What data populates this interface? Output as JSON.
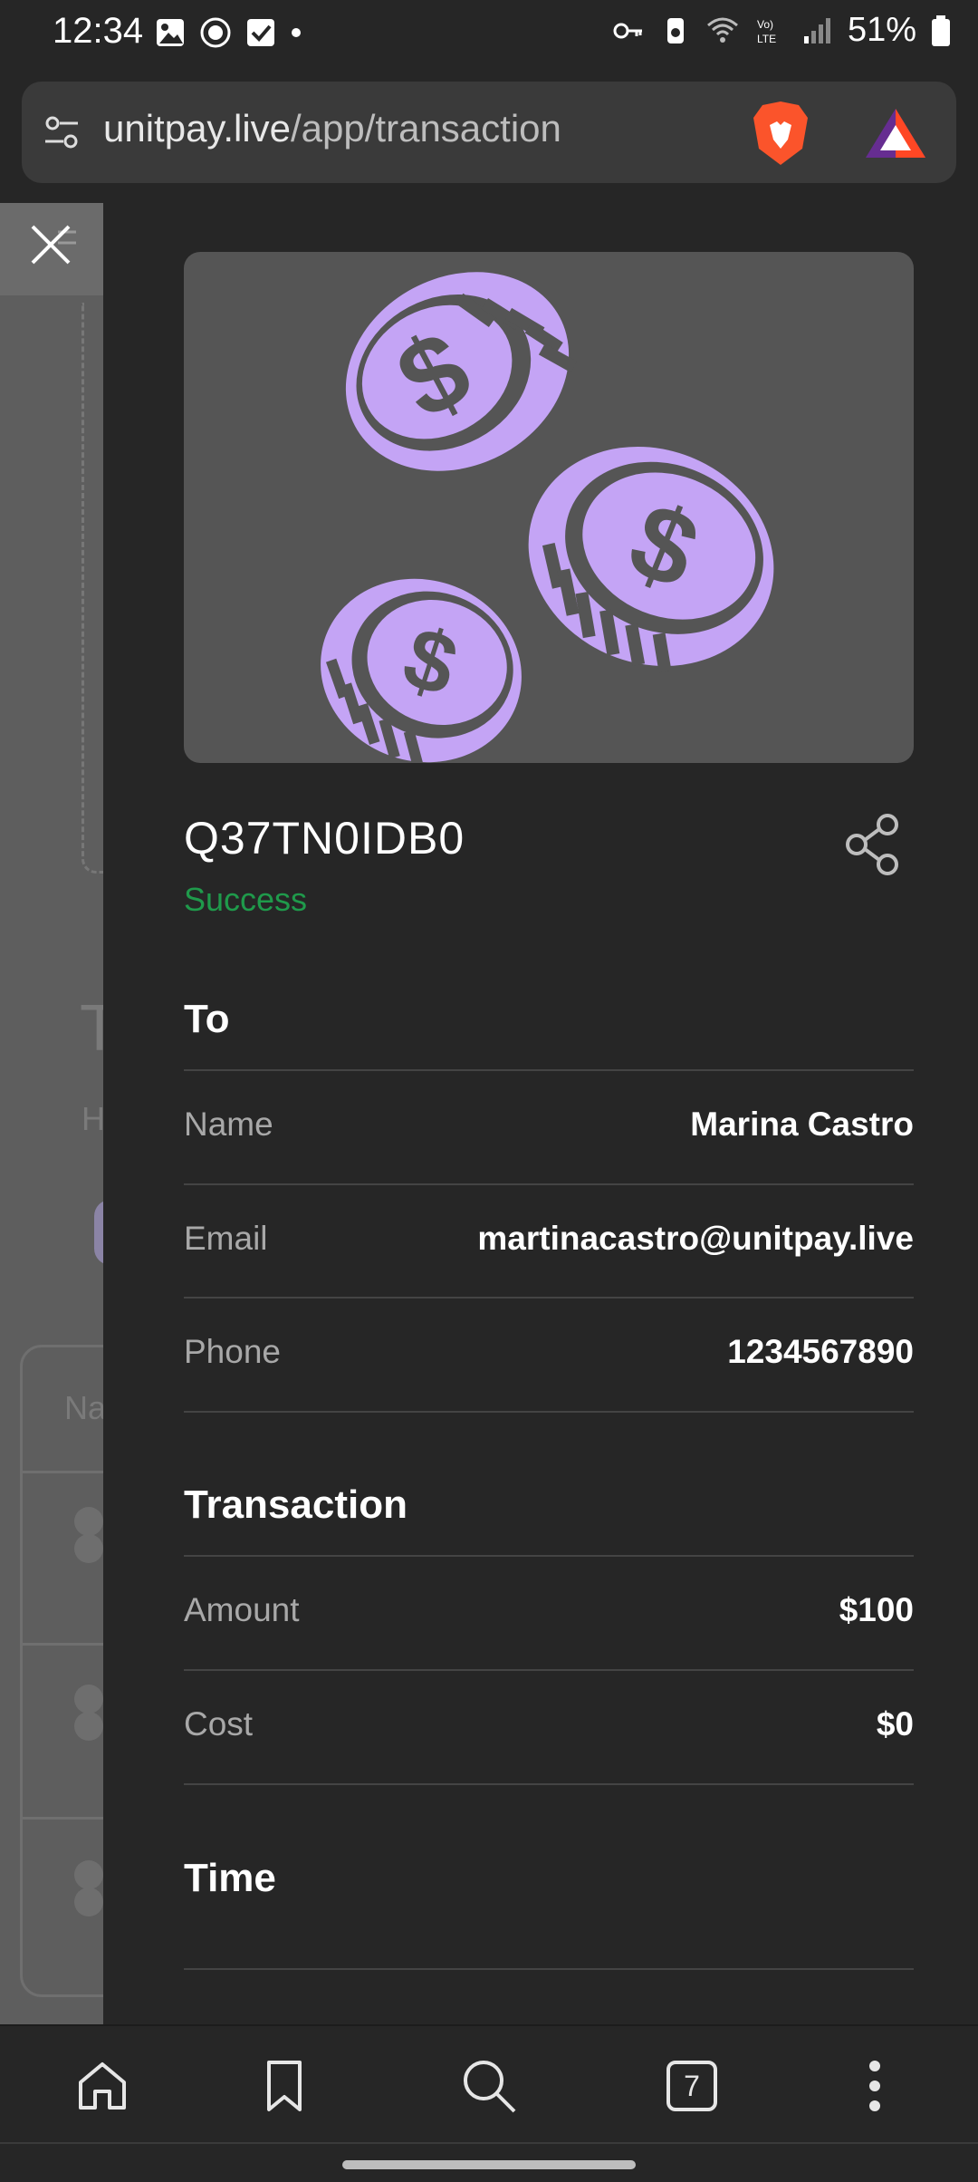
{
  "status_bar": {
    "time": "12:34",
    "battery": "51%"
  },
  "browser": {
    "url_host": "unitpay.live",
    "url_path": "/app/transaction",
    "tabs_count": "7"
  },
  "transaction": {
    "id": "Q37TN0IDB0",
    "status": "Success",
    "status_color": "#1f9a4b",
    "hero_icon_color": "#c4a4f5"
  },
  "sections": {
    "to": {
      "title": "To",
      "rows": [
        {
          "label": "Name",
          "value": "Marina Castro"
        },
        {
          "label": "Email",
          "value": "martinacastro@unitpay.live"
        },
        {
          "label": "Phone",
          "value": "1234567890"
        }
      ]
    },
    "transaction": {
      "title": "Transaction",
      "rows": [
        {
          "label": "Amount",
          "value": "$100"
        },
        {
          "label": "Cost",
          "value": "$0"
        }
      ]
    },
    "time": {
      "title": "Time"
    }
  },
  "background_page": {
    "heading_fragment": "T",
    "sub_fragment": "H",
    "table_header_fragment": "Na"
  }
}
